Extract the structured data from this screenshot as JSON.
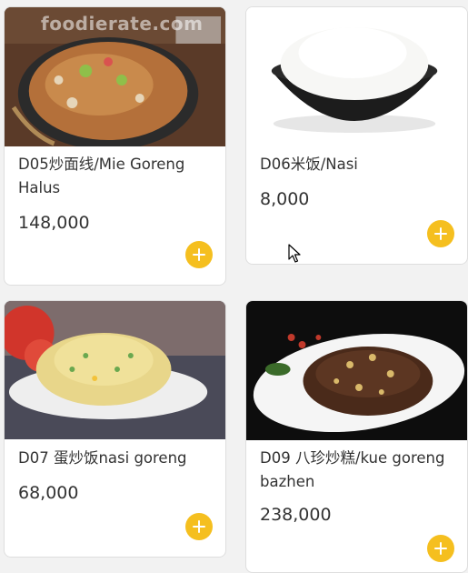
{
  "menu": {
    "items": [
      {
        "name": "D05炒面线/Mie Goreng Halus",
        "price": "148,000",
        "add_icon": "plus-icon",
        "watermark": "foodierate.com"
      },
      {
        "name": "D06米饭/Nasi",
        "price": "8,000",
        "add_icon": "plus-icon"
      },
      {
        "name": "D07 蛋炒饭nasi goreng",
        "price": "68,000",
        "add_icon": "plus-icon"
      },
      {
        "name": "D09 八珍炒糕/kue goreng bazhen",
        "price": "238,000",
        "add_icon": "plus-icon"
      }
    ]
  },
  "colors": {
    "accent": "#f5bf1f",
    "card_bg": "#ffffff",
    "page_bg": "#f2f2f2",
    "text": "#333333"
  }
}
